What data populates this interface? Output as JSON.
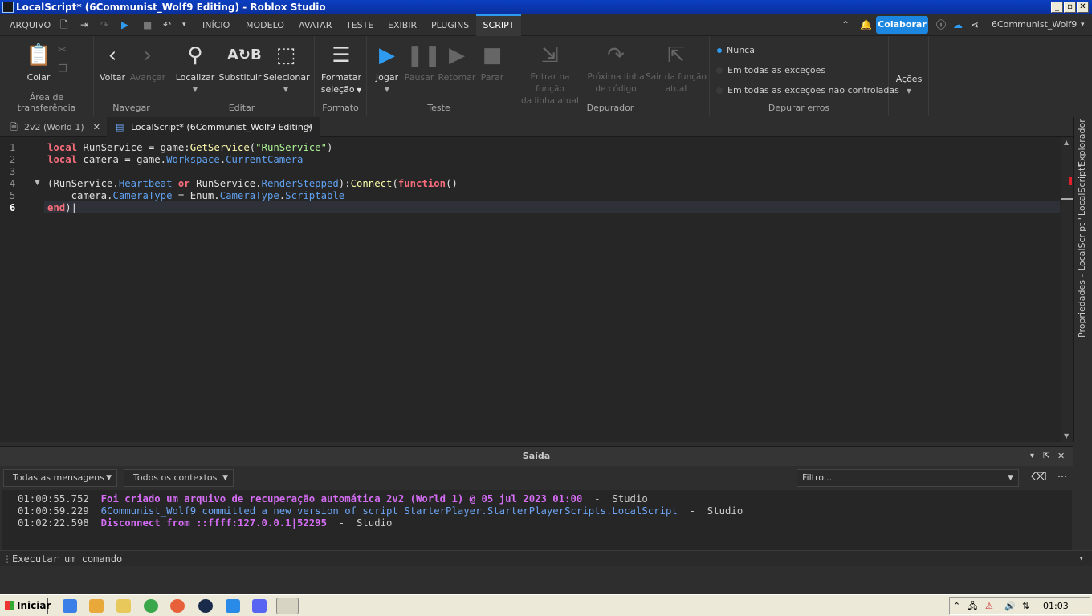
{
  "window": {
    "title": "LocalScript* (6Communist_Wolf9 Editing) - Roblox Studio"
  },
  "menubar": {
    "file": "ARQUIVO",
    "tabs": [
      "INÍCIO",
      "MODELO",
      "AVATAR",
      "TESTE",
      "EXIBIR",
      "PLUGINS",
      "SCRIPT"
    ],
    "active_tab": "SCRIPT",
    "collaborate": "Colaborar",
    "username": "6Communist_Wolf9"
  },
  "ribbon": {
    "clipboard": {
      "paste": "Colar",
      "group": "Área de transferência"
    },
    "navigate": {
      "back": "Voltar",
      "forward": "Avançar",
      "group": "Navegar"
    },
    "edit": {
      "find": "Localizar",
      "replace": "Substituir",
      "select": "Selecionar",
      "group": "Editar"
    },
    "format": {
      "format_line1": "Formatar",
      "format_line2": "seleção",
      "group": "Formato"
    },
    "test": {
      "play": "Jogar",
      "pause": "Pausar",
      "resume": "Retomar",
      "stop": "Parar",
      "group": "Teste"
    },
    "debugger": {
      "step_into_l1": "Entrar na função",
      "step_into_l2": "da linha atual",
      "step_over_l1": "Próxima linha",
      "step_over_l2": "de código",
      "step_out_l1": "Sair da função",
      "step_out_l2": "atual",
      "group": "Depurador"
    },
    "debug_errors": {
      "never": "Nunca",
      "all": "Em todas as exceções",
      "unhandled": "Em todas as exceções não controladas",
      "group": "Depurar erros"
    },
    "actions": "Ações"
  },
  "doc_tabs": [
    {
      "label": "2v2 (World 1)"
    },
    {
      "label": "LocalScript* (6Communist_Wolf9 Editing)"
    }
  ],
  "side_panel": {
    "explorer": "Explorador",
    "properties": "Propriedades - LocalScript \"LocalScript\""
  },
  "editor": {
    "line_numbers": [
      "1",
      "2",
      "3",
      "4",
      "5",
      "6"
    ]
  },
  "output": {
    "title": "Saída",
    "filter_messages": "Todas as mensagens",
    "filter_contexts": "Todos os contextos",
    "filter_placeholder": "Filtro...",
    "logs": [
      {
        "time": "01:00:55.752",
        "msg": "Foi criado um arquivo de recuperação automática 2v2 (World 1) @ 05 jul 2023 01:00",
        "src": "  -  Studio"
      },
      {
        "time": "01:00:59.229",
        "msg": "6Communist_Wolf9 committed a new version of script StarterPlayer.StarterPlayerScripts.LocalScript",
        "src": "  -  Studio"
      },
      {
        "time": "01:02:22.598",
        "msg": "Disconnect from ::ffff:127.0.0.1|52295",
        "src": "  -  Studio"
      }
    ]
  },
  "command_bar": {
    "placeholder": "Executar um comando"
  },
  "taskbar": {
    "start": "Iniciar",
    "clock": "01:03"
  }
}
